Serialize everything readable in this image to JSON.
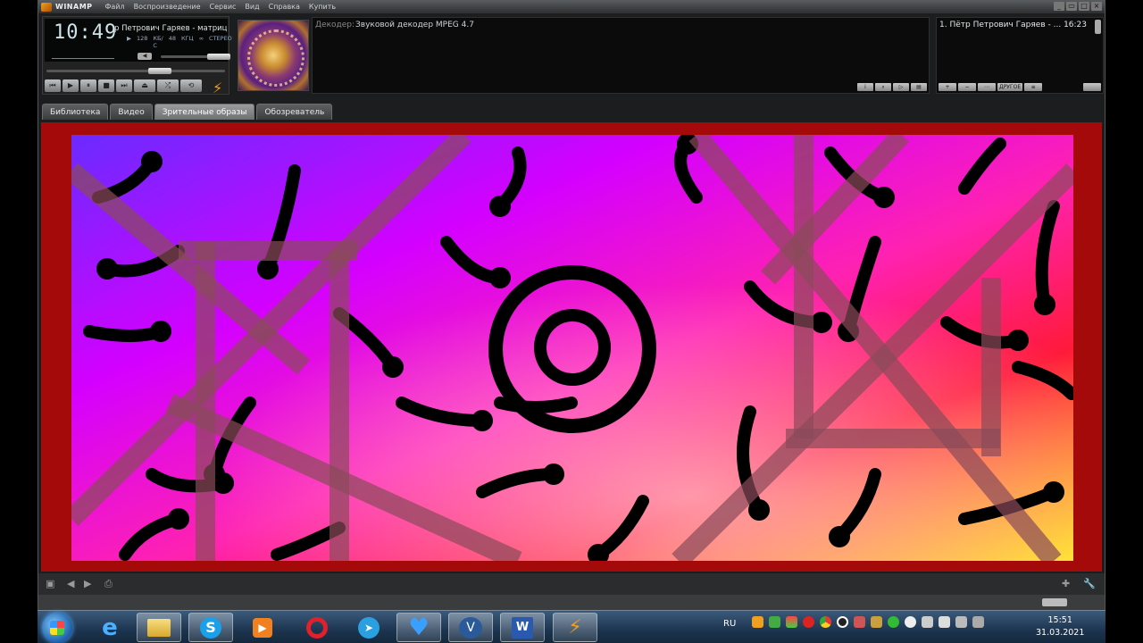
{
  "app": {
    "name": "WINAMP",
    "menu": [
      "Файл",
      "Воспроизведение",
      "Сервис",
      "Вид",
      "Справка",
      "Купить"
    ]
  },
  "player": {
    "time": "10:49",
    "scroll_title": "р Петрович Гаряев - матриц",
    "kbps": "128",
    "kbps_unit": "КБ/С",
    "khz": "48",
    "khz_unit": "КГЦ",
    "mode": "СТЕРЕО"
  },
  "decoder": {
    "label": "Декодер:",
    "value": "Звуковой декодер MPEG 4.7"
  },
  "playlist": {
    "item": "1. Пётр Петрович Гаряев - ...",
    "duration": "16:23",
    "buttons": [
      "+",
      "−",
      "⋯",
      "ДРУГОЕ",
      "≡"
    ]
  },
  "tabs": [
    "Библиотека",
    "Видео",
    "Зрительные образы",
    "Обозреватель"
  ],
  "active_tab": "Зрительные образы",
  "taskbar": {
    "lang": "RU",
    "time": "15:51",
    "date": "31.03.2021",
    "apps": [
      "ie-icon",
      "explorer-icon",
      "skype-icon",
      "media-player-icon",
      "opera-icon",
      "telegram-icon",
      "heart-icon",
      "eye-icon",
      "word-icon",
      "winamp-icon"
    ]
  }
}
